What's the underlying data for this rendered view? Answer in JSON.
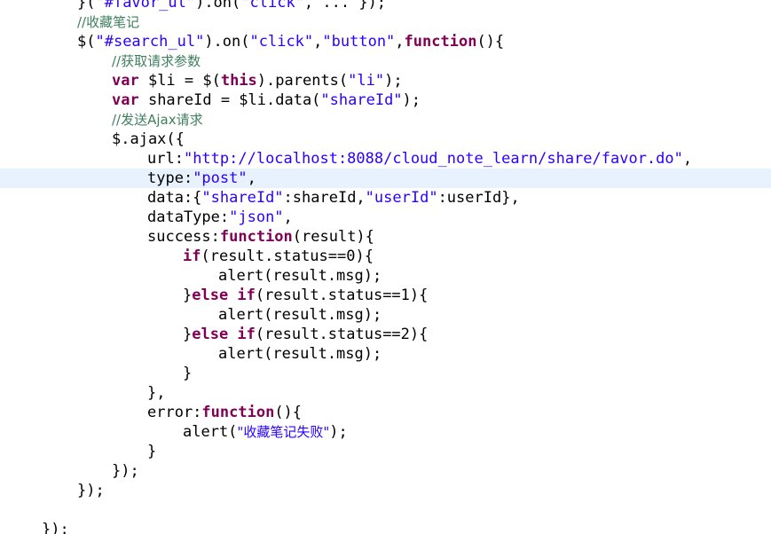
{
  "editor": {
    "language": "javascript",
    "current_line_index": 9,
    "colors": {
      "background": "#ffffff",
      "keyword": "#7f0055",
      "string": "#2a00ff",
      "comment": "#3f7f5f",
      "default": "#000000",
      "current_line": "#e8f2fe"
    },
    "lines": [
      [
        {
          "t": "d",
          "s": "}("
        },
        {
          "t": "s",
          "s": "\"#favor_ul\""
        },
        {
          "t": "d",
          "s": ").on("
        },
        {
          "t": "s",
          "s": "\"click\""
        },
        {
          "t": "d",
          "s": ", ... });"
        }
      ],
      [
        {
          "t": "c",
          "s": "//收藏笔记"
        }
      ],
      [
        {
          "t": "d",
          "s": "$("
        },
        {
          "t": "s",
          "s": "\"#search_ul\""
        },
        {
          "t": "d",
          "s": ").on("
        },
        {
          "t": "s",
          "s": "\"click\""
        },
        {
          "t": "d",
          "s": ","
        },
        {
          "t": "s",
          "s": "\"button\""
        },
        {
          "t": "d",
          "s": ","
        },
        {
          "t": "k",
          "s": "function"
        },
        {
          "t": "d",
          "s": "(){"
        }
      ],
      [
        {
          "t": "c",
          "s": "//获取请求参数"
        }
      ],
      [
        {
          "t": "k",
          "s": "var"
        },
        {
          "t": "d",
          "s": " $li = $("
        },
        {
          "t": "k",
          "s": "this"
        },
        {
          "t": "d",
          "s": ").parents("
        },
        {
          "t": "s",
          "s": "\"li\""
        },
        {
          "t": "d",
          "s": ");"
        }
      ],
      [
        {
          "t": "k",
          "s": "var"
        },
        {
          "t": "d",
          "s": " shareId = $li.data("
        },
        {
          "t": "s",
          "s": "\"shareId\""
        },
        {
          "t": "d",
          "s": ");"
        }
      ],
      [
        {
          "t": "c",
          "s": "//发送Ajax请求"
        }
      ],
      [
        {
          "t": "d",
          "s": "$.ajax({"
        }
      ],
      [
        {
          "t": "d",
          "s": "url:"
        },
        {
          "t": "s",
          "s": "\"http://localhost:8088/cloud_note_learn/share/favor.do\""
        },
        {
          "t": "d",
          "s": ","
        }
      ],
      [
        {
          "t": "d",
          "s": "type:"
        },
        {
          "t": "s",
          "s": "\"post\""
        },
        {
          "t": "d",
          "s": ","
        }
      ],
      [
        {
          "t": "d",
          "s": "data:{"
        },
        {
          "t": "s",
          "s": "\"shareId\""
        },
        {
          "t": "d",
          "s": ":shareId,"
        },
        {
          "t": "s",
          "s": "\"userId\""
        },
        {
          "t": "d",
          "s": ":userId},"
        }
      ],
      [
        {
          "t": "d",
          "s": "dataType:"
        },
        {
          "t": "s",
          "s": "\"json\""
        },
        {
          "t": "d",
          "s": ","
        }
      ],
      [
        {
          "t": "d",
          "s": "success:"
        },
        {
          "t": "k",
          "s": "function"
        },
        {
          "t": "d",
          "s": "(result){"
        }
      ],
      [
        {
          "t": "k",
          "s": "if"
        },
        {
          "t": "d",
          "s": "(result.status==0){"
        }
      ],
      [
        {
          "t": "d",
          "s": "alert(result.msg);"
        }
      ],
      [
        {
          "t": "d",
          "s": "}"
        },
        {
          "t": "k",
          "s": "else if"
        },
        {
          "t": "d",
          "s": "(result.status==1){"
        }
      ],
      [
        {
          "t": "d",
          "s": "alert(result.msg);"
        }
      ],
      [
        {
          "t": "d",
          "s": "}"
        },
        {
          "t": "k",
          "s": "else if"
        },
        {
          "t": "d",
          "s": "(result.status==2){"
        }
      ],
      [
        {
          "t": "d",
          "s": "alert(result.msg);"
        }
      ],
      [
        {
          "t": "d",
          "s": "}"
        }
      ],
      [
        {
          "t": "d",
          "s": "},"
        }
      ],
      [
        {
          "t": "d",
          "s": "error:"
        },
        {
          "t": "k",
          "s": "function"
        },
        {
          "t": "d",
          "s": "(){"
        }
      ],
      [
        {
          "t": "d",
          "s": "alert("
        },
        {
          "t": "s",
          "s": "\"收藏笔记失败\""
        },
        {
          "t": "d",
          "s": ");"
        }
      ],
      [
        {
          "t": "d",
          "s": "}"
        }
      ],
      [
        {
          "t": "d",
          "s": "});"
        }
      ],
      [
        {
          "t": "d",
          "s": "});"
        }
      ],
      [],
      [
        {
          "t": "d",
          "s": "});"
        }
      ]
    ]
  }
}
